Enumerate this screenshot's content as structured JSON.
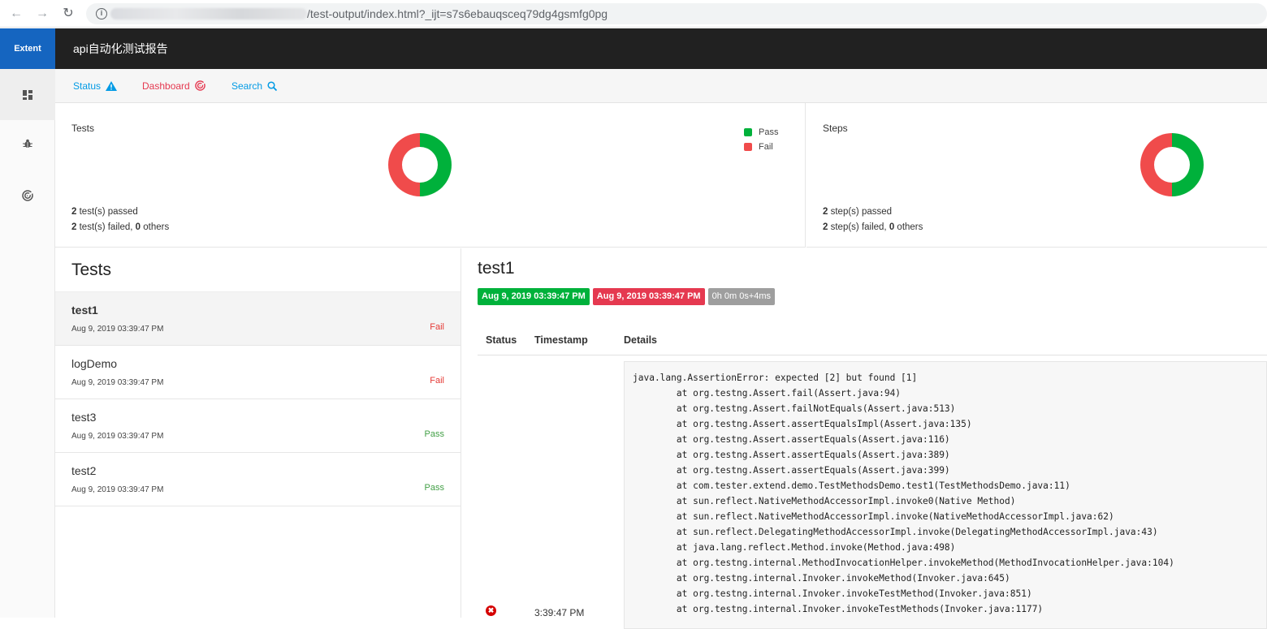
{
  "browser": {
    "url_path": "/test-output/index.html?_ijt=s7s6ebauqsceq79dg4gsmfg0pg"
  },
  "app": {
    "brand": "Extent",
    "report_name": "api自动化测试报告"
  },
  "subnav": {
    "status": "Status",
    "dashboard": "Dashboard",
    "search": "Search"
  },
  "colors": {
    "pass": "#00b13b",
    "fail": "#f04b4b",
    "brand": "#1565c0"
  },
  "tests_card": {
    "title": "Tests",
    "legend_pass": "Pass",
    "legend_fail": "Fail",
    "passed_count": "2",
    "passed_text": " test(s) passed",
    "failed_count": "2",
    "failed_text": " test(s) failed, ",
    "others_count": "0",
    "others_text": " others",
    "pass_fraction": 0.5
  },
  "steps_card": {
    "title": "Steps",
    "passed_count": "2",
    "passed_text": " step(s) passed",
    "failed_count": "2",
    "failed_text": " step(s) failed, ",
    "others_count": "0",
    "others_text": " others",
    "pass_fraction": 0.5
  },
  "test_list": {
    "header": "Tests",
    "items": [
      {
        "name": "test1",
        "time": "Aug 9, 2019 03:39:47 PM",
        "status": "Fail"
      },
      {
        "name": "logDemo",
        "time": "Aug 9, 2019 03:39:47 PM",
        "status": "Fail"
      },
      {
        "name": "test3",
        "time": "Aug 9, 2019 03:39:47 PM",
        "status": "Pass"
      },
      {
        "name": "test2",
        "time": "Aug 9, 2019 03:39:47 PM",
        "status": "Pass"
      }
    ]
  },
  "detail": {
    "title": "test1",
    "start": "Aug 9, 2019 03:39:47 PM",
    "end": "Aug 9, 2019 03:39:47 PM",
    "duration": "0h 0m 0s+4ms",
    "col_status": "Status",
    "col_timestamp": "Timestamp",
    "col_details": "Details",
    "log_time": "3:39:47 PM",
    "stacktrace": "java.lang.AssertionError: expected [2] but found [1]\n\tat org.testng.Assert.fail(Assert.java:94)\n\tat org.testng.Assert.failNotEquals(Assert.java:513)\n\tat org.testng.Assert.assertEqualsImpl(Assert.java:135)\n\tat org.testng.Assert.assertEquals(Assert.java:116)\n\tat org.testng.Assert.assertEquals(Assert.java:389)\n\tat org.testng.Assert.assertEquals(Assert.java:399)\n\tat com.tester.extend.demo.TestMethodsDemo.test1(TestMethodsDemo.java:11)\n\tat sun.reflect.NativeMethodAccessorImpl.invoke0(Native Method)\n\tat sun.reflect.NativeMethodAccessorImpl.invoke(NativeMethodAccessorImpl.java:62)\n\tat sun.reflect.DelegatingMethodAccessorImpl.invoke(DelegatingMethodAccessorImpl.java:43)\n\tat java.lang.reflect.Method.invoke(Method.java:498)\n\tat org.testng.internal.MethodInvocationHelper.invokeMethod(MethodInvocationHelper.java:104)\n\tat org.testng.internal.Invoker.invokeMethod(Invoker.java:645)\n\tat org.testng.internal.Invoker.invokeTestMethod(Invoker.java:851)\n\tat org.testng.internal.Invoker.invokeTestMethods(Invoker.java:1177)"
  }
}
